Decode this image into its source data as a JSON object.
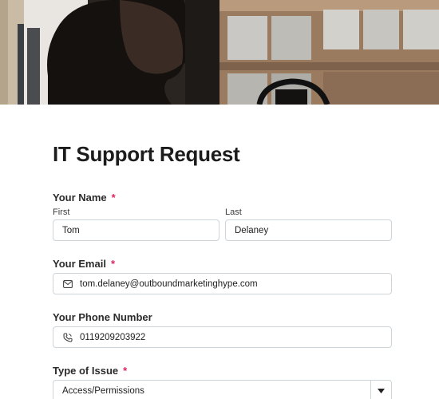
{
  "form": {
    "title": "IT Support Request",
    "required_mark": "*",
    "name": {
      "label": "Your Name",
      "first_label": "First",
      "last_label": "Last",
      "first_value": "Tom",
      "last_value": "Delaney"
    },
    "email": {
      "label": "Your Email",
      "value": "tom.delaney@outboundmarketinghype.com",
      "icon": "mail-icon"
    },
    "phone": {
      "label": "Your Phone Number",
      "value": "0119209203922",
      "icon": "phone-icon"
    },
    "issue": {
      "label": "Type of Issue",
      "selected": "Access/Permissions",
      "icon": "chevron-down-icon"
    }
  },
  "colors": {
    "required": "#e0245e",
    "border": "#cfd4d9",
    "text": "#1c1c1c"
  }
}
